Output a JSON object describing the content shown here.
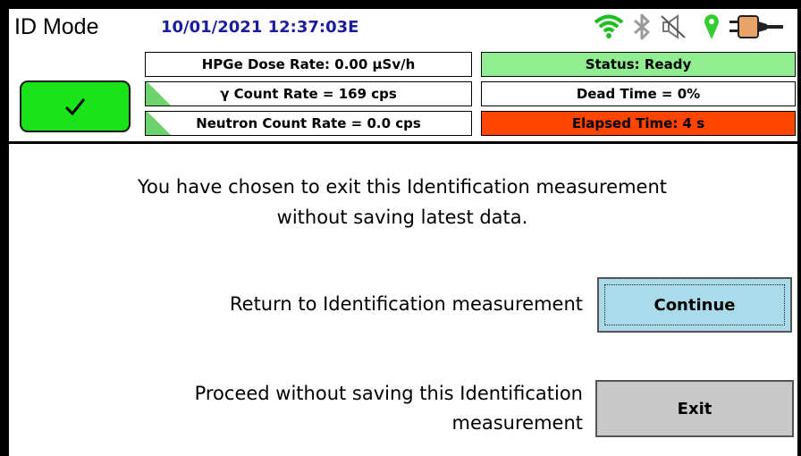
{
  "header": {
    "mode": "ID Mode",
    "datetime": "10/01/2021 12:37:03E"
  },
  "status_icons": [
    "wifi-icon",
    "bluetooth-icon",
    "speaker-muted-icon",
    "location-pin-icon",
    "power-plug-icon"
  ],
  "ok_button": {
    "icon": "checkmark-icon"
  },
  "readouts": {
    "dose_rate": "HPGe Dose Rate: 0.00  µSv/h",
    "gamma_count": "γ Count Rate = 169 cps",
    "neutron_count": "Neutron Count Rate = 0.0 cps",
    "status": "Status: Ready",
    "dead_time": "Dead Time = 0%",
    "elapsed": "Elapsed Time: 4 s"
  },
  "colors": {
    "status_bg": "#90ee90",
    "elapsed_bg": "#ff4500",
    "ok_bg": "#18e418",
    "continue_bg": "#a9dbea",
    "exit_bg": "#c8c8c8",
    "datetime": "#1b1d9c",
    "wifi": "#1bbf1b",
    "pin": "#33cc33",
    "plug": "#e8a468"
  },
  "message": {
    "line1": "You have chosen to exit this Identification measurement",
    "line2": "without saving latest data."
  },
  "continue_row": {
    "label": "Return to Identification measurement",
    "button": "Continue"
  },
  "exit_row": {
    "label_line1": "Proceed without saving this Identification",
    "label_line2": "measurement",
    "button": "Exit"
  }
}
